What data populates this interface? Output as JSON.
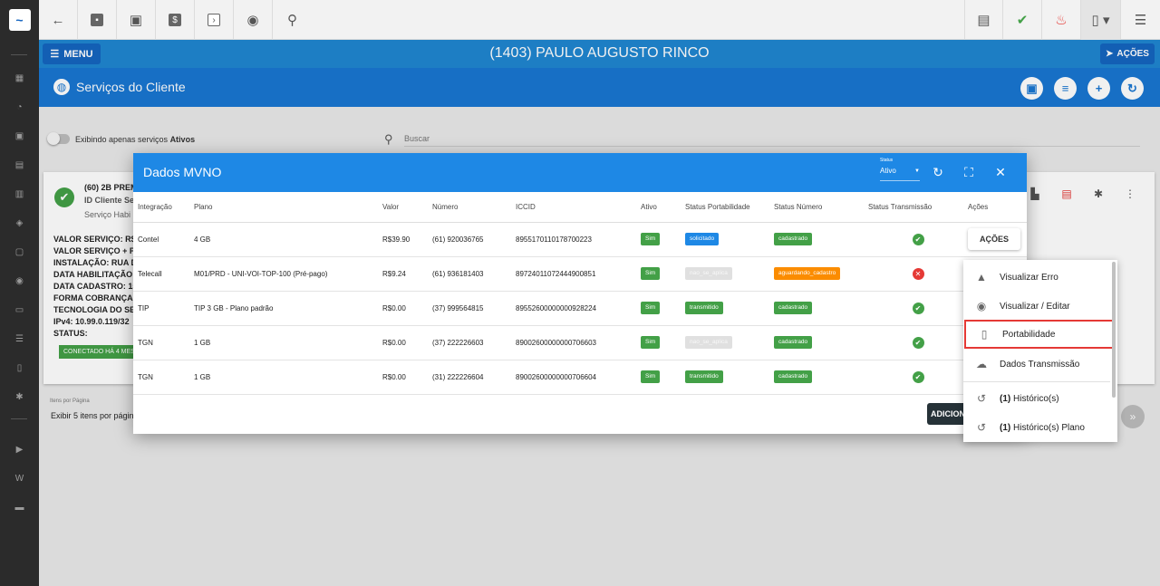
{
  "rail": {
    "logo": "~"
  },
  "header": {
    "menu_label": "MENU",
    "client_name": "(1403) PAULO AUGUSTO RINCO",
    "acoes_label": "AÇÕES"
  },
  "page": {
    "title": "Serviços do Cliente"
  },
  "filter": {
    "toggle_label": "Exibindo apenas serviços ",
    "toggle_bold": "Ativos",
    "search_placeholder": "Buscar"
  },
  "card": {
    "service_title": "(60) 2B PREM",
    "service_id": "ID Cliente Se",
    "service_sub": "Serviço Habi",
    "lines": [
      "VALOR SERVIÇO: R$1",
      "VALOR SERVIÇO + PA",
      "INSTALAÇÃO: RUA DO",
      "DATA HABILITAÇÃO:",
      "DATA CADASTRO: 15",
      "FORMA COBRANÇA:",
      "TECNOLOGIA DO SER",
      "IPv4: 10.99.0.119/32",
      "STATUS:"
    ],
    "connected_label": "CONECTADO HÁ 4 MES",
    "per_page_label": "Itens por Página",
    "per_page_value": "Exibir 5 itens por página"
  },
  "modal": {
    "title": "Dados MVNO",
    "status_label": "Status",
    "status_value": "Ativo",
    "columns": [
      "Integração",
      "Plano",
      "Valor",
      "Número",
      "ICCID",
      "Ativo",
      "Status Portabilidade",
      "Status Número",
      "Status Transmissão",
      "Ações"
    ],
    "rows": [
      {
        "integracao": "Contel",
        "plano": "4 GB",
        "valor": "R$39.90",
        "numero": "(61) 920036765",
        "iccid": "8955170110178700223",
        "ativo": "Sim",
        "portabilidade": "solicitado",
        "status_numero": "cadastrado"
      },
      {
        "integracao": "Telecall",
        "plano": "M01/PRD - UNI-VOI-TOP-100 (Pré-pago)",
        "valor": "R$9.24",
        "numero": "(61) 936181403",
        "iccid": "89724011072444900851",
        "ativo": "Sim",
        "portabilidade": "nao_se_aplica",
        "status_numero": "aguardando_cadastro"
      },
      {
        "integracao": "TIP",
        "plano": "TIP 3 GB - Plano padrão",
        "valor": "R$0.00",
        "numero": "(37) 999564815",
        "iccid": "89552600000000928224",
        "ativo": "Sim",
        "portabilidade": "transmitido",
        "status_numero": "cadastrado"
      },
      {
        "integracao": "TGN",
        "plano": "1 GB",
        "valor": "R$0.00",
        "numero": "(37) 222226603",
        "iccid": "89002600000000706603",
        "ativo": "Sim",
        "portabilidade": "nao_se_aplica",
        "status_numero": "cadastrado"
      },
      {
        "integracao": "TGN",
        "plano": "1 GB",
        "valor": "R$0.00",
        "numero": "(31) 222226604",
        "iccid": "89002600000000706604",
        "ativo": "Sim",
        "portabilidade": "transmitido",
        "status_numero": "cadastrado"
      }
    ],
    "acoes_button": "AÇÕES",
    "add_button": "ADICION"
  },
  "dropdown": {
    "items": [
      {
        "label": "Visualizar Erro",
        "icon": "warning-icon"
      },
      {
        "label": "Visualizar / Editar",
        "icon": "eye-icon"
      },
      {
        "label": "Portabilidade",
        "icon": "phone-icon"
      },
      {
        "label": "Dados Transmissão",
        "icon": "cloud-upload-icon"
      },
      {
        "count": "(1)",
        "label": " Histórico(s)",
        "icon": "history-icon"
      },
      {
        "count": "(1)",
        "label": " Histórico(s) Plano",
        "icon": "history-icon"
      }
    ]
  },
  "colors": {
    "primary": "#1e88e5",
    "header_dark": "#1565c0",
    "success": "#43a047",
    "danger": "#e53935",
    "warning": "#fb8c00"
  }
}
